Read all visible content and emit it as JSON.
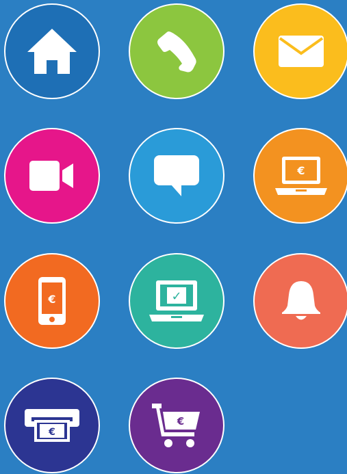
{
  "background_color": "#2b7fc3",
  "tiles": [
    {
      "name": "home",
      "icon": "home-icon",
      "color": "#1e6fb5"
    },
    {
      "name": "phone",
      "icon": "phone-icon",
      "color": "#8cc63f"
    },
    {
      "name": "mail",
      "icon": "envelope-icon",
      "color": "#fbbd1d"
    },
    {
      "name": "video",
      "icon": "video-camera-icon",
      "color": "#e6168a"
    },
    {
      "name": "chat",
      "icon": "chat-bubble-icon",
      "color": "#2a9bd8"
    },
    {
      "name": "laptop-euro",
      "icon": "laptop-euro-icon",
      "color": "#f39220"
    },
    {
      "name": "phone-euro",
      "icon": "smartphone-euro-icon",
      "color": "#f26a21"
    },
    {
      "name": "laptop-check",
      "icon": "laptop-check-icon",
      "color": "#2db39e"
    },
    {
      "name": "bell",
      "icon": "bell-icon",
      "color": "#ef6b52"
    },
    {
      "name": "atm",
      "icon": "atm-euro-icon",
      "color": "#2c3592"
    },
    {
      "name": "cart",
      "icon": "shopping-cart-euro-icon",
      "color": "#6a2c8f"
    }
  ],
  "symbols": {
    "euro": "€",
    "check": "✓"
  }
}
